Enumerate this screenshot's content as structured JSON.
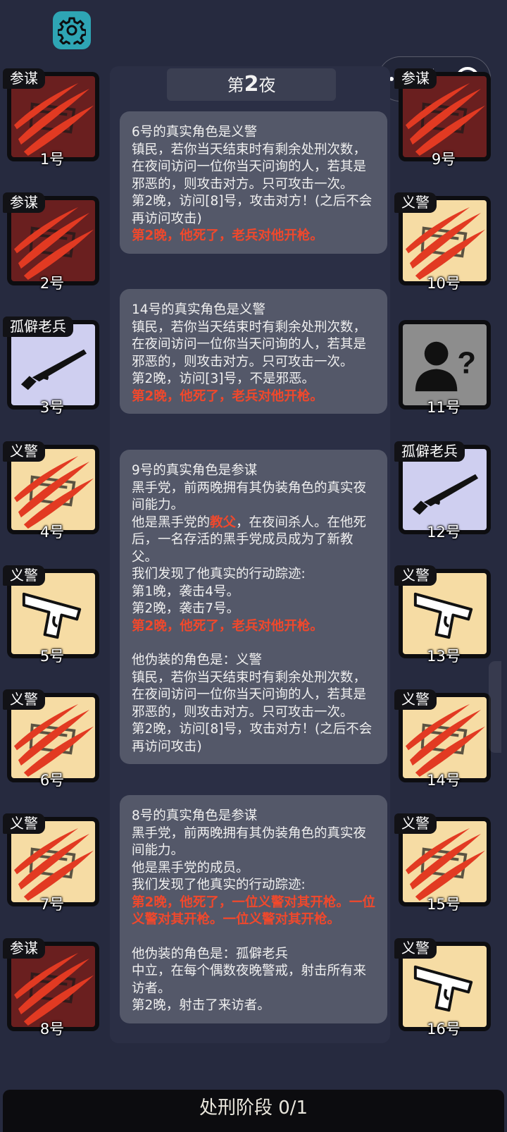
{
  "night": {
    "prefix": "第",
    "number": "2",
    "suffix": "夜"
  },
  "players": [
    {
      "num": "1号",
      "role": "参谋",
      "art": "red",
      "icon": "claw-scratch-icon"
    },
    {
      "num": "2号",
      "role": "参谋",
      "art": "red",
      "icon": "claw-scratch-icon"
    },
    {
      "num": "3号",
      "role": "孤僻老兵",
      "art": "lav",
      "icon": "rifle-icon"
    },
    {
      "num": "4号",
      "role": "义警",
      "art": "cream",
      "icon": "claw-scratch-icon"
    },
    {
      "num": "5号",
      "role": "义警",
      "art": "cream",
      "icon": "pistol-icon"
    },
    {
      "num": "6号",
      "role": "义警",
      "art": "cream",
      "icon": "claw-scratch-icon"
    },
    {
      "num": "7号",
      "role": "义警",
      "art": "cream",
      "icon": "claw-scratch-icon"
    },
    {
      "num": "8号",
      "role": "参谋",
      "art": "red",
      "icon": "claw-scratch-icon"
    },
    {
      "num": "9号",
      "role": "参谋",
      "art": "red",
      "icon": "claw-scratch-icon"
    },
    {
      "num": "10号",
      "role": "义警",
      "art": "cream",
      "icon": "claw-scratch-icon"
    },
    {
      "num": "11号",
      "role": "",
      "art": "gray",
      "icon": "unknown-person-icon"
    },
    {
      "num": "12号",
      "role": "孤僻老兵",
      "art": "lav",
      "icon": "rifle-icon"
    },
    {
      "num": "13号",
      "role": "义警",
      "art": "cream",
      "icon": "pistol-icon"
    },
    {
      "num": "14号",
      "role": "义警",
      "art": "cream",
      "icon": "claw-scratch-icon"
    },
    {
      "num": "15号",
      "role": "义警",
      "art": "cream",
      "icon": "claw-scratch-icon"
    },
    {
      "num": "16号",
      "role": "义警",
      "art": "cream",
      "icon": "pistol-icon"
    }
  ],
  "entries": [
    {
      "lines": [
        {
          "t": "6号的真实角色是义警"
        },
        {
          "t": "镇民，若你当天结束时有剩余处刑次数，在夜间访问一位你当天问询的人，若其是邪恶的，则攻击对方。只可攻击一次。"
        },
        {
          "t": "第2晚，访问[8]号，攻击对方！(之后不会再访问攻击)"
        },
        {
          "t": "第2晚，他死了，老兵对他开枪。",
          "red": true
        }
      ]
    },
    {
      "lines": [
        {
          "t": "14号的真实角色是义警"
        },
        {
          "t": "镇民，若你当天结束时有剩余处刑次数，在夜间访问一位你当天问询的人，若其是邪恶的，则攻击对方。只可攻击一次。"
        },
        {
          "t": "第2晚，访问[3]号，不是邪恶。"
        },
        {
          "t": "第2晚，他死了，老兵对他开枪。",
          "red": true
        }
      ]
    },
    {
      "lines": [
        {
          "t": "9号的真实角色是参谋"
        },
        {
          "t": "黑手党，前两晚拥有其伪装角色的真实夜间能力。"
        },
        {
          "pre": "他是黑手党的",
          "hl": "教父",
          "post": "，在夜间杀人。在他死后，一名存活的黑手党成员成为了新教父。"
        },
        {
          "t": "我们发现了他真实的行动踪迹:"
        },
        {
          "t": "第1晚，袭击4号。"
        },
        {
          "t": "第2晚，袭击7号。"
        },
        {
          "t": "第2晚，他死了，老兵对他开枪。",
          "red": true
        },
        {
          "gap": true
        },
        {
          "t": "他伪装的角色是：义警"
        },
        {
          "t": "镇民，若你当天结束时有剩余处刑次数，在夜间访问一位你当天问询的人，若其是邪恶的，则攻击对方。只可攻击一次。"
        },
        {
          "t": "第2晚，访问[8]号，攻击对方！(之后不会再访问攻击)"
        }
      ]
    },
    {
      "lines": [
        {
          "t": "8号的真实角色是参谋"
        },
        {
          "t": "黑手党，前两晚拥有其伪装角色的真实夜间能力。"
        },
        {
          "t": "他是黑手党的成员。"
        },
        {
          "t": "我们发现了他真实的行动踪迹:"
        },
        {
          "t": "第2晚，他死了，一位义警对其开枪。一位义警对其开枪。一位义警对其开枪。",
          "red": true
        },
        {
          "gap": true
        },
        {
          "t": "他伪装的角色是：孤僻老兵"
        },
        {
          "t": "中立，在每个偶数夜晚警戒，射击所有来访者。"
        },
        {
          "t": "第2晚，射击了来访者。"
        }
      ]
    }
  ],
  "bottom": {
    "label": "处刑阶段 0/1"
  },
  "colors": {
    "background": "#262a3f",
    "entry": "#545869",
    "accent_red": "#f0482c",
    "settings": "#2ea5b4"
  }
}
